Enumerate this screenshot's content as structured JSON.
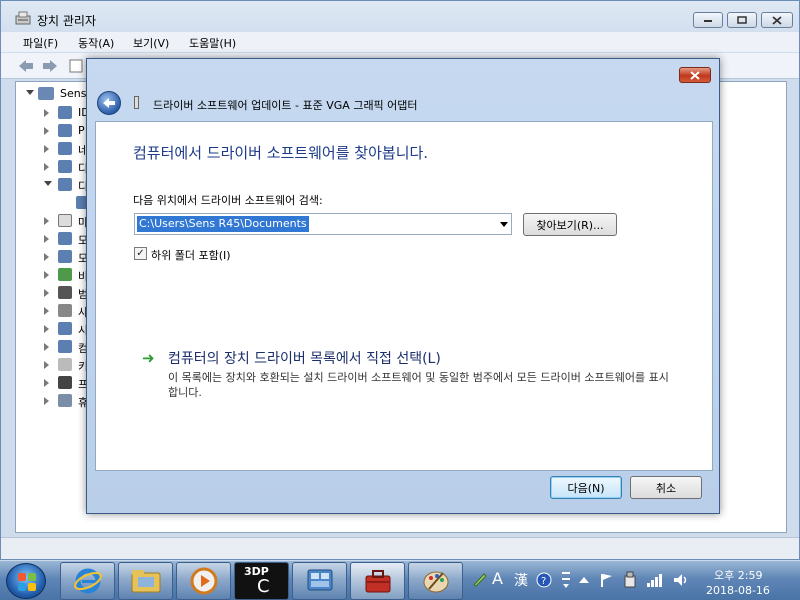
{
  "app": {
    "title": "장치 관리자",
    "menu": [
      "파일(F)",
      "동작(A)",
      "보기(V)",
      "도움말(H)"
    ],
    "root_label": "Sens",
    "tree_labels": [
      "ID",
      "P",
      "네",
      "디",
      "디",
      "마",
      "모",
      "모",
      "비",
      "범",
      "사",
      "시",
      "컴",
      "키",
      "프",
      "휴"
    ]
  },
  "dialog": {
    "title": "드라이버 소프트웨어 업데이트 - 표준 VGA 그래픽 어댑터",
    "heading": "컴퓨터에서 드라이버 소프트웨어를 찾아봅니다.",
    "search_label": "다음 위치에서 드라이버 소프트웨어 검색:",
    "path_value": "C:\\Users\\Sens R45\\Documents",
    "browse_label": "찾아보기(R)...",
    "include_subfolders_label": "하위 폴더 포함(I)",
    "include_subfolders_checked": true,
    "pick_link": "컴퓨터의 장치 드라이버 목록에서 직접 선택(L)",
    "pick_desc": "이 목록에는 장치와 호환되는 설치 드라이버 소프트웨어 및 동일한 범주에서 모든 드라이버 소프트웨어를 표시합니다.",
    "next_label": "다음(N)",
    "cancel_label": "취소"
  },
  "taskbar": {
    "app_3dp_label": "3DP",
    "app_3dp_letter": "C",
    "lang_label": "A",
    "hanja_label": "漢",
    "clock_time": "오후 2:59",
    "clock_date": "2018-08-16"
  },
  "colors": {
    "heading": "#1e3b8a",
    "selection": "#3178d5",
    "link_arrow": "#2f9a2f"
  }
}
